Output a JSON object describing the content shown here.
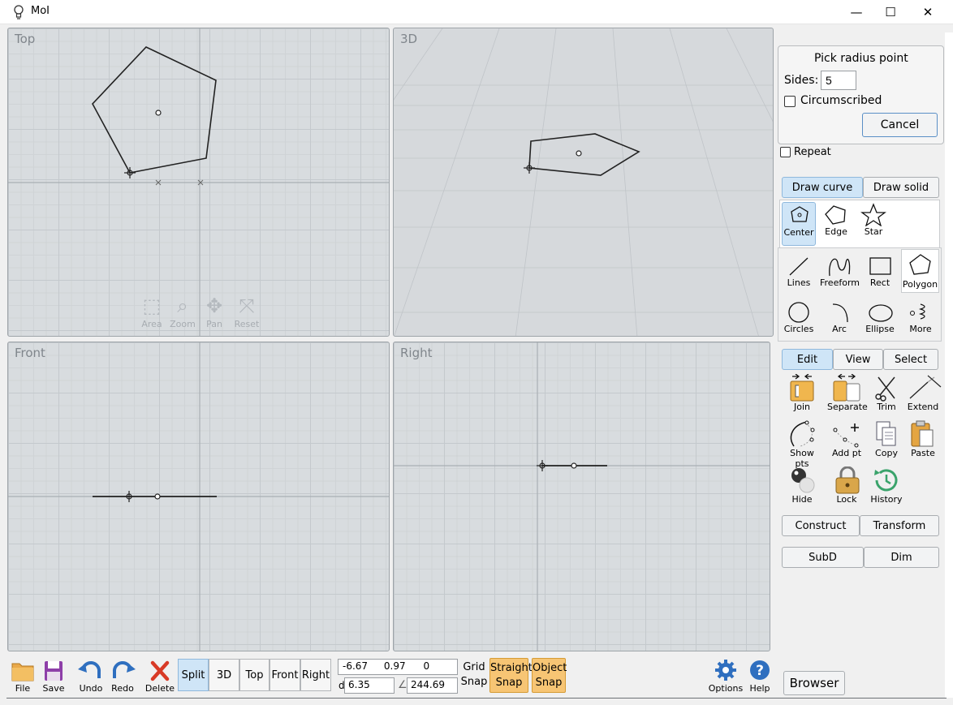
{
  "window": {
    "title": "MoI",
    "minimize": "—",
    "maximize": "☐",
    "close": "✕"
  },
  "viewports": {
    "top": {
      "label": "Top"
    },
    "three_d": {
      "label": "3D"
    },
    "front": {
      "label": "Front"
    },
    "right": {
      "label": "Right"
    },
    "nav_tools": [
      {
        "label": "Area",
        "icon": "area-zoom-icon"
      },
      {
        "label": "Zoom",
        "icon": "magnifier-icon"
      },
      {
        "label": "Pan",
        "icon": "pan-arrows-icon"
      },
      {
        "label": "Reset",
        "icon": "reset-view-icon"
      }
    ]
  },
  "prompt": {
    "title": "Pick radius point",
    "sides_label": "Sides:",
    "sides_value": "5",
    "circumscribed_label": "Circumscribed",
    "circumscribed_checked": false,
    "cancel_label": "Cancel",
    "repeat_label": "Repeat",
    "repeat_checked": false
  },
  "draw_tabs": {
    "curve": "Draw curve",
    "solid": "Draw solid",
    "active": "curve"
  },
  "polygon_subtools": [
    {
      "label": "Center",
      "icon": "polygon-center-icon",
      "selected": true
    },
    {
      "label": "Edge",
      "icon": "polygon-edge-icon",
      "selected": false
    },
    {
      "label": "Star",
      "icon": "star-icon",
      "selected": false
    }
  ],
  "curve_tools": [
    {
      "label": "Lines",
      "icon": "line-icon"
    },
    {
      "label": "Freeform",
      "icon": "freeform-curve-icon"
    },
    {
      "label": "Rect",
      "icon": "rectangle-icon"
    },
    {
      "label": "Polygon",
      "icon": "polygon-icon"
    },
    {
      "label": "Circles",
      "icon": "circle-icon"
    },
    {
      "label": "Arc",
      "icon": "arc-icon"
    },
    {
      "label": "Ellipse",
      "icon": "ellipse-icon"
    },
    {
      "label": "More",
      "icon": "more-curves-icon"
    }
  ],
  "edit_tabs": {
    "edit": "Edit",
    "view": "View",
    "select": "Select",
    "active": "edit"
  },
  "edit_tools": [
    {
      "label": "Join",
      "icon": "join-icon"
    },
    {
      "label": "Separate",
      "icon": "separate-icon"
    },
    {
      "label": "Trim",
      "icon": "scissors-icon"
    },
    {
      "label": "Extend",
      "icon": "extend-icon"
    },
    {
      "label": "Show pts",
      "icon": "show-points-icon"
    },
    {
      "label": "Add pt",
      "icon": "add-point-icon"
    },
    {
      "label": "Copy",
      "icon": "copy-icon"
    },
    {
      "label": "Paste",
      "icon": "paste-icon"
    },
    {
      "label": "Hide",
      "icon": "hide-icon"
    },
    {
      "label": "Lock",
      "icon": "lock-icon"
    },
    {
      "label": "History",
      "icon": "history-icon"
    }
  ],
  "construct_tabs": {
    "construct": "Construct",
    "transform": "Transform"
  },
  "subd_tabs": {
    "subd": "SubD",
    "dim": "Dim"
  },
  "bottom": {
    "file": "File",
    "save": "Save",
    "undo": "Undo",
    "redo": "Redo",
    "delete": "Delete",
    "views": [
      {
        "label": "Split",
        "active": true
      },
      {
        "label": "3D",
        "active": false
      },
      {
        "label": "Top",
        "active": false
      },
      {
        "label": "Front",
        "active": false
      },
      {
        "label": "Right",
        "active": false
      }
    ],
    "coords": {
      "x": "-6.67",
      "y": "0.97",
      "z": "0"
    },
    "distance_label": "d",
    "distance_value": "6.35",
    "angle_label": "∠",
    "angle_value": "244.69",
    "grid_snap_line1": "Grid",
    "grid_snap_line2": "Snap",
    "straight_snap_line1": "Straight",
    "straight_snap_line2": "Snap",
    "object_snap_line1": "Object",
    "object_snap_line2": "Snap",
    "options": "Options",
    "help": "Help",
    "browser": "Browser"
  },
  "colors": {
    "accent": "#cfe5f7",
    "snap_active": "#f7c574",
    "delete_red": "#d83a26",
    "icon_blue": "#2f6fbf"
  }
}
